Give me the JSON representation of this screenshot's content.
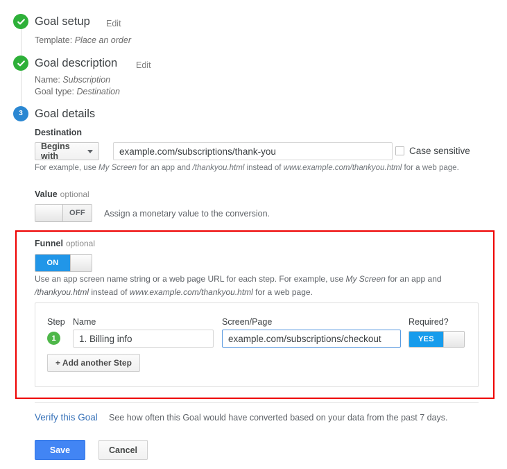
{
  "colors": {
    "green": "#2eb039",
    "blue": "#2b87d2",
    "toggle_on": "#2196e8",
    "highlight_red": "#ee0000",
    "primary": "#4285f4",
    "link": "#3973b9"
  },
  "steps": [
    {
      "marker": "check-icon",
      "title": "Goal setup",
      "edit_label": "Edit",
      "details": [
        {
          "label": "Template:",
          "value": "Place an order"
        }
      ]
    },
    {
      "marker": "check-icon",
      "title": "Goal description",
      "edit_label": "Edit",
      "details": [
        {
          "label": "Name:",
          "value": "Subscription"
        },
        {
          "label": "Goal type:",
          "value": "Destination"
        }
      ]
    },
    {
      "marker": "3",
      "title": "Goal details",
      "edit_label": "",
      "details": []
    }
  ],
  "destination": {
    "label": "Destination",
    "match_type": "Begins with",
    "url_value": "example.com/subscriptions/thank-you",
    "case_sensitive_label": "Case sensitive",
    "case_sensitive_checked": false,
    "helper_parts": {
      "a": "For example, use ",
      "b": "My Screen",
      "c": " for an app and ",
      "d": "/thankyou.html",
      "e": " instead of ",
      "f": "www.example.com/thankyou.html",
      "g": " for a web page."
    }
  },
  "value_section": {
    "label": "Value",
    "optional_tag": "optional",
    "toggle_state": "OFF",
    "description": "Assign a monetary value to the conversion."
  },
  "funnel_section": {
    "label": "Funnel",
    "optional_tag": "optional",
    "toggle_state": "ON",
    "helper_parts": {
      "a": "Use an app screen name string or a web page URL for each step. For example, use ",
      "b": "My Screen",
      "c": " for an app and ",
      "d": "/thankyou.html",
      "e": " instead of ",
      "f": "www.example.com/thankyou.html",
      "g": " for a web page."
    },
    "table": {
      "headers": {
        "step": "Step",
        "name": "Name",
        "screen_page": "Screen/Page",
        "required": "Required?"
      },
      "rows": [
        {
          "step_number": "1",
          "name": "1. Billing info",
          "screen_page": "example.com/subscriptions/checkout",
          "required_toggle": "YES"
        }
      ]
    },
    "add_step_label": "+ Add another Step"
  },
  "verify": {
    "link_label": "Verify this Goal",
    "note": "See how often this Goal would have converted based on your data from the past 7 days."
  },
  "actions": {
    "save_label": "Save",
    "cancel_label": "Cancel"
  }
}
